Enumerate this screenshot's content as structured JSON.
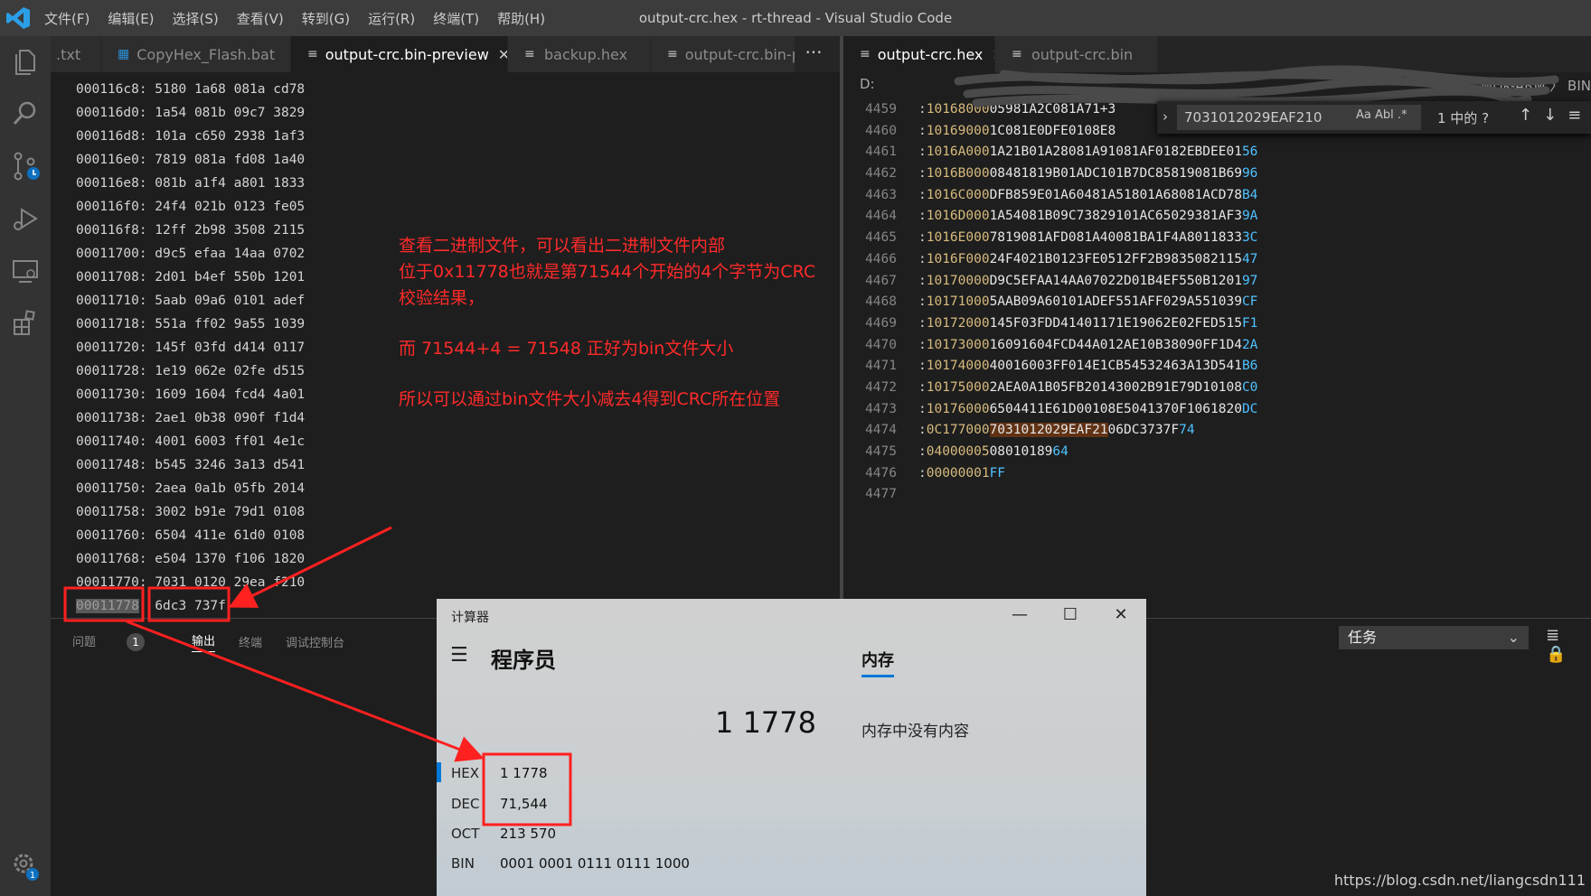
{
  "titlebar": {
    "menu": [
      "文件(F)",
      "编辑(E)",
      "选择(S)",
      "查看(V)",
      "转到(G)",
      "运行(R)",
      "终端(T)",
      "帮助(H)"
    ],
    "title": "output-crc.hex - rt-thread - Visual Studio Code"
  },
  "tabs_left": [
    {
      "label": ".txt",
      "active": false
    },
    {
      "label": "CopyHex_Flash.bat",
      "active": false
    },
    {
      "label": "output-crc.bin-preview",
      "active": true
    },
    {
      "label": "backup.hex",
      "active": false
    },
    {
      "label": "output-crc.bin-p",
      "active": false
    }
  ],
  "tabs_right": [
    {
      "label": "output-crc.hex",
      "active": true
    },
    {
      "label": "output-crc.bin",
      "active": false
    }
  ],
  "more_label": "···",
  "hex_rows": [
    "000116c8: 5180 1a68 081a cd78",
    "000116d0: 1a54 081b 09c7 3829",
    "000116d8: 101a c650 2938 1af3",
    "000116e0: 7819 081a fd08 1a40",
    "000116e8: 081b a1f4 a801 1833",
    "000116f0: 24f4 021b 0123 fe05",
    "000116f8: 12ff 2b98 3508 2115",
    "00011700: d9c5 efaa 14aa 0702",
    "00011708: 2d01 b4ef 550b 1201",
    "00011710: 5aab 09a6 0101 adef",
    "00011718: 551a ff02 9a55 1039",
    "00011720: 145f 03fd d414 0117",
    "00011728: 1e19 062e 02fe d515",
    "00011730: 1609 1604 fcd4 4a01",
    "00011738: 2ae1 0b38 090f f1d4",
    "00011740: 4001 6003 ff01 4e1c",
    "00011748: b545 3246 3a13 d541",
    "00011750: 2aea 0a1b 05fb 2014",
    "00011758: 3002 b91e 79d1 0108",
    "00011760: 6504 411e 61d0 0108",
    "00011768: e504 1370 f106 1820",
    "00011770: 7031 0120 29ea f210"
  ],
  "hex_last": {
    "addr": "00011778",
    "sep": ": ",
    "data": "6dc3 737f"
  },
  "note": {
    "line1": "查看二进制文件，可以看出二进制文件内部",
    "line2": "位于0x11778也就是第71544个开始的4个字节为CRC",
    "line3": "校验结果，",
    "line4": "而 71544+4 = 71548  正好为bin文件大小",
    "line5": "所以可以通过bin文件大小减去4得到CRC所在位置"
  },
  "breadcrumb": {
    "head": "D:",
    "tail": "MDK-ARM  〉 BIN"
  },
  "find": {
    "query": "7031012029EAF210",
    "result": "1 中的 ?",
    "opts": "Aa  Abl  .*"
  },
  "hex_lines": [
    {
      "n": "4459",
      "a": "10168000",
      "b": "05981A2C081A71+3",
      "c": ""
    },
    {
      "n": "4460",
      "a": "10169000",
      "b": "1C081E0DFE0108E8",
      "c": ""
    },
    {
      "n": "4461",
      "a": "1016A000",
      "b": "1A21B01A28081A91081AF0182EBDEE01",
      "c": "56"
    },
    {
      "n": "4462",
      "a": "1016B000",
      "b": "08481819B01ADC101B7DC85819081B69",
      "c": "96"
    },
    {
      "n": "4463",
      "a": "1016C000",
      "b": "DFB859E01A60481A51801A68081ACD78",
      "c": "B4"
    },
    {
      "n": "4464",
      "a": "1016D000",
      "b": "1A54081B09C73829101AC65029381AF3",
      "c": "9A"
    },
    {
      "n": "4465",
      "a": "1016E000",
      "b": "7819081AFD081A40081BA1F4A8011833",
      "c": "3C"
    },
    {
      "n": "4466",
      "a": "1016F000",
      "b": "24F4021B0123FE0512FF2B9835082115",
      "c": "47"
    },
    {
      "n": "4467",
      "a": "10170000",
      "b": "D9C5EFAA14AA07022D01B4EF550B1201",
      "c": "97"
    },
    {
      "n": "4468",
      "a": "10171000",
      "b": "5AAB09A60101ADEF551AFF029A551039",
      "c": "CF"
    },
    {
      "n": "4469",
      "a": "10172000",
      "b": "145F03FDD41401171E19062E02FED515",
      "c": "F1"
    },
    {
      "n": "4470",
      "a": "10173000",
      "b": "16091604FCD44A012AE10B38090FF1D4",
      "c": "2A"
    },
    {
      "n": "4471",
      "a": "10174000",
      "b": "40016003FF014E1CB54532463A13D541",
      "c": "B6"
    },
    {
      "n": "4472",
      "a": "10175000",
      "b": "2AEA0A1B05FB20143002B91E79D10108",
      "c": "C0"
    },
    {
      "n": "4473",
      "a": "10176000",
      "b": "6504411E61D00108E5041370F1061820",
      "c": "DC"
    }
  ],
  "line_4474": {
    "n": "4474",
    "a": "0C177000",
    "find": "7031012029EAF21",
    "b": "06DC3737F",
    "c": "74"
  },
  "line_4475": {
    "n": "4475",
    "a": "04000005",
    "b": "08010189",
    "c": "64"
  },
  "line_4476": {
    "n": "4476",
    "a": "00000001",
    "b": "",
    "c": "FF"
  },
  "line_4477": {
    "n": "4477"
  },
  "panel": {
    "tabs": [
      "问题",
      "输出",
      "终端",
      "调试控制台"
    ],
    "problems_count": "1",
    "task_select": "任务",
    "watermark": "https://blog.csdn.net/liangcsdn111"
  },
  "calculator": {
    "title": "计算器",
    "mode": "程序员",
    "memory_tab": "内存",
    "display": "1 1778",
    "memory_empty": "内存中没有内容",
    "radix": [
      {
        "label": "HEX",
        "value": "1 1778"
      },
      {
        "label": "DEC",
        "value": "71,544"
      },
      {
        "label": "OCT",
        "value": "213 570"
      },
      {
        "label": "BIN",
        "value": "0001 0001 0111 0111 1000"
      }
    ]
  },
  "colors": {
    "annotation_red": "#ff2a2a",
    "accent_blue": "#0078d7",
    "vscode_logo": "#2b9fe6"
  },
  "icons": [
    "vscode-logo",
    "explorer-icon",
    "search-icon",
    "source-control-icon",
    "run-debug-icon",
    "remote-explorer-icon",
    "extensions-icon",
    "settings-gear-icon",
    "file-icon",
    "close-icon",
    "chevron-down-icon",
    "arrow-up-icon",
    "arrow-down-icon",
    "hamburger-icon",
    "minimize-icon",
    "maximize-icon"
  ]
}
